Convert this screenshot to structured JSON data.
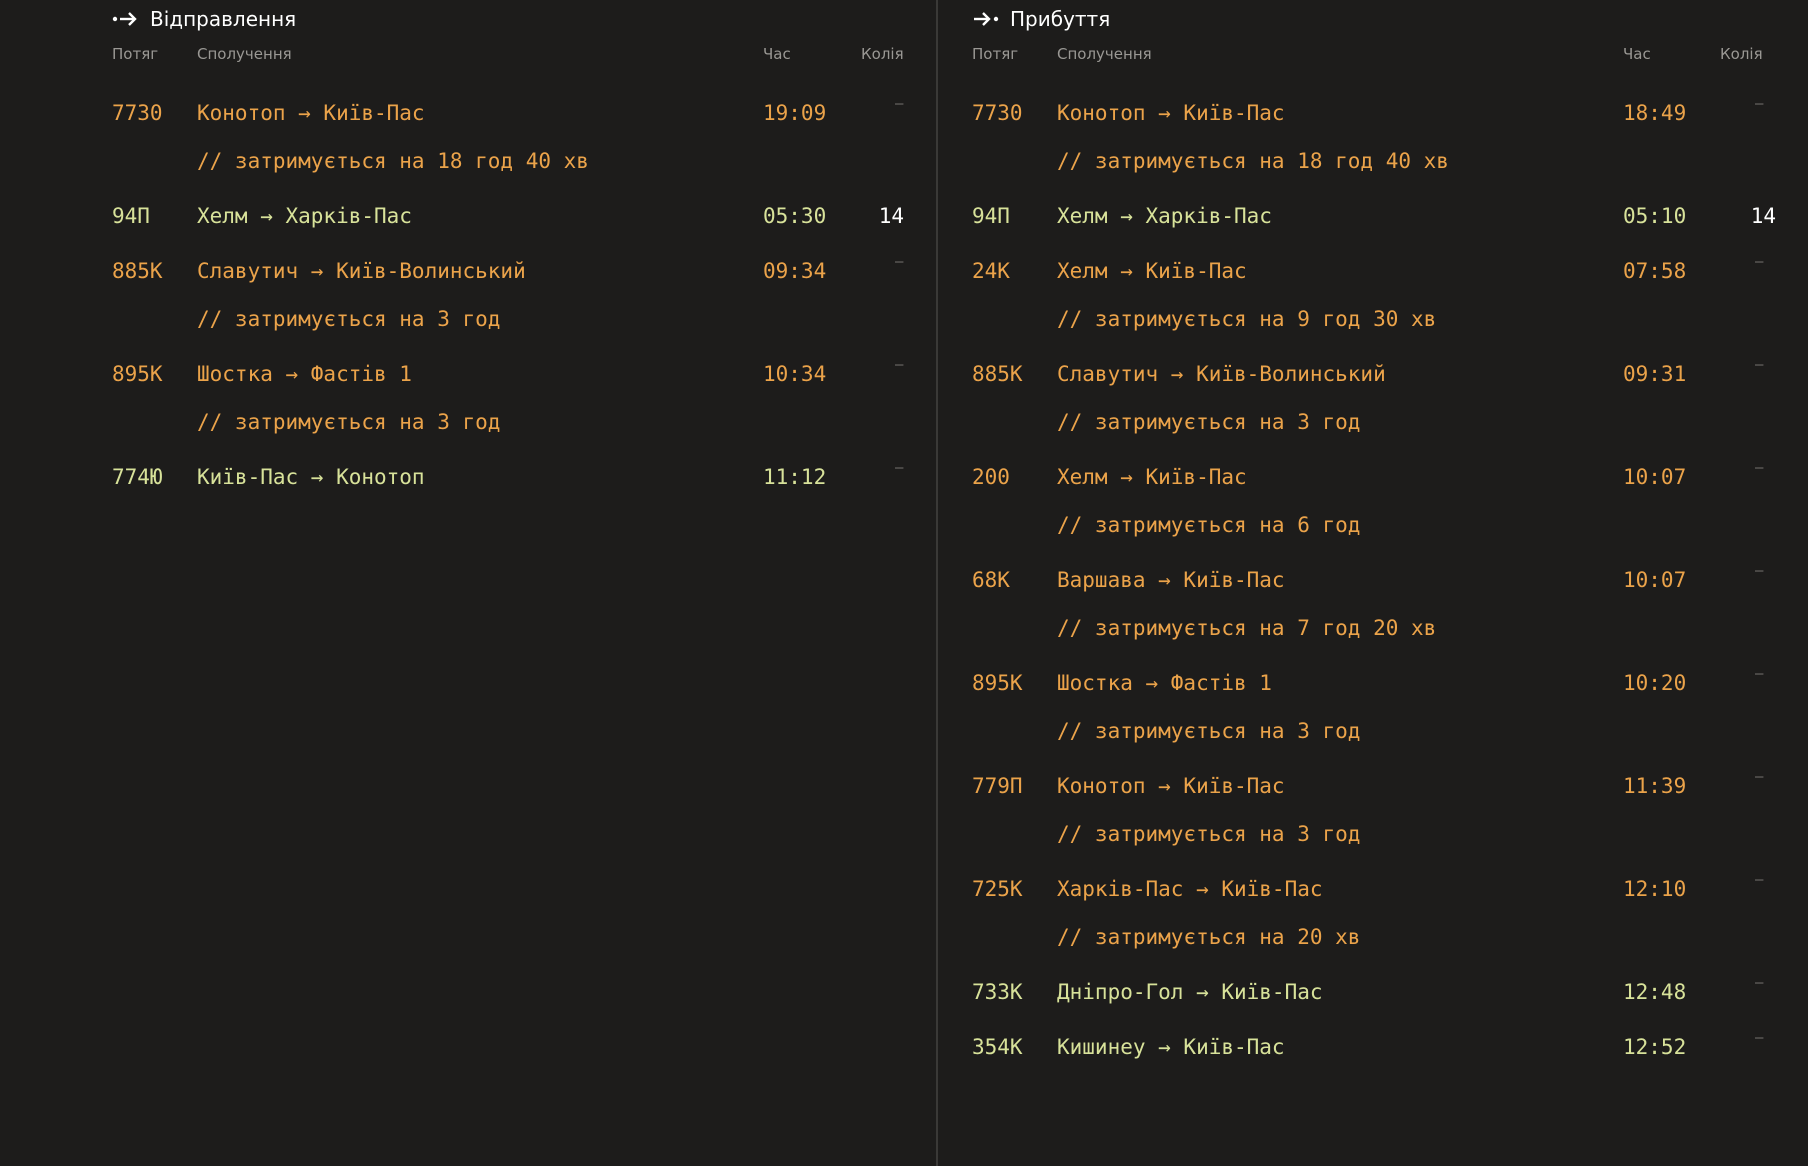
{
  "colors": {
    "background": "#1d1c1b",
    "delayed": "#eba34a",
    "on_time": "#d8e29a",
    "track": "#ffffff",
    "header": "#9a9894"
  },
  "columns": {
    "train": "Потяг",
    "route": "Сполучення",
    "time": "Час",
    "track": "Колія"
  },
  "departures": {
    "title": "Відправлення",
    "icon": "departure-arrow-icon",
    "rows": [
      {
        "train": "7730",
        "route": "Конотоп → Київ-Пас",
        "time": "19:09",
        "track": "–",
        "note": "// затримується на 18 год 40 хв",
        "status": "delayed"
      },
      {
        "train": "94П",
        "route": "Хелм → Харків-Пас",
        "time": "05:30",
        "track": "14",
        "note": "",
        "status": "on_time"
      },
      {
        "train": "885К",
        "route": "Славутич → Київ-Волинський",
        "time": "09:34",
        "track": "–",
        "note": "// затримується на 3 год",
        "status": "delayed"
      },
      {
        "train": "895К",
        "route": "Шостка → Фастів 1",
        "time": "10:34",
        "track": "–",
        "note": "// затримується на 3 год",
        "status": "delayed"
      },
      {
        "train": "774Ю",
        "route": "Київ-Пас → Конотоп",
        "time": "11:12",
        "track": "–",
        "note": "",
        "status": "on_time"
      }
    ]
  },
  "arrivals": {
    "title": "Прибуття",
    "icon": "arrival-arrow-icon",
    "rows": [
      {
        "train": "7730",
        "route": "Конотоп → Київ-Пас",
        "time": "18:49",
        "track": "–",
        "note": "// затримується на 18 год 40 хв",
        "status": "delayed"
      },
      {
        "train": "94П",
        "route": "Хелм → Харків-Пас",
        "time": "05:10",
        "track": "14",
        "note": "",
        "status": "on_time"
      },
      {
        "train": "24К",
        "route": "Хелм → Київ-Пас",
        "time": "07:58",
        "track": "–",
        "note": "// затримується на 9 год 30 хв",
        "status": "delayed"
      },
      {
        "train": "885К",
        "route": "Славутич → Київ-Волинський",
        "time": "09:31",
        "track": "–",
        "note": "// затримується на 3 год",
        "status": "delayed"
      },
      {
        "train": "200",
        "route": "Хелм → Київ-Пас",
        "time": "10:07",
        "track": "–",
        "note": "// затримується на 6 год",
        "status": "delayed"
      },
      {
        "train": "68К",
        "route": "Варшава → Київ-Пас",
        "time": "10:07",
        "track": "–",
        "note": "// затримується на 7 год 20 хв",
        "status": "delayed"
      },
      {
        "train": "895К",
        "route": "Шостка → Фастів 1",
        "time": "10:20",
        "track": "–",
        "note": "// затримується на 3 год",
        "status": "delayed"
      },
      {
        "train": "779П",
        "route": "Конотоп → Київ-Пас",
        "time": "11:39",
        "track": "–",
        "note": "// затримується на 3 год",
        "status": "delayed"
      },
      {
        "train": "725К",
        "route": "Харків-Пас → Київ-Пас",
        "time": "12:10",
        "track": "–",
        "note": "// затримується на 20 хв",
        "status": "delayed"
      },
      {
        "train": "733К",
        "route": "Дніпро-Гол → Київ-Пас",
        "time": "12:48",
        "track": "–",
        "note": "",
        "status": "on_time"
      },
      {
        "train": "354К",
        "route": "Кишинеу → Київ-Пас",
        "time": "12:52",
        "track": "–",
        "note": "",
        "status": "on_time"
      }
    ]
  }
}
